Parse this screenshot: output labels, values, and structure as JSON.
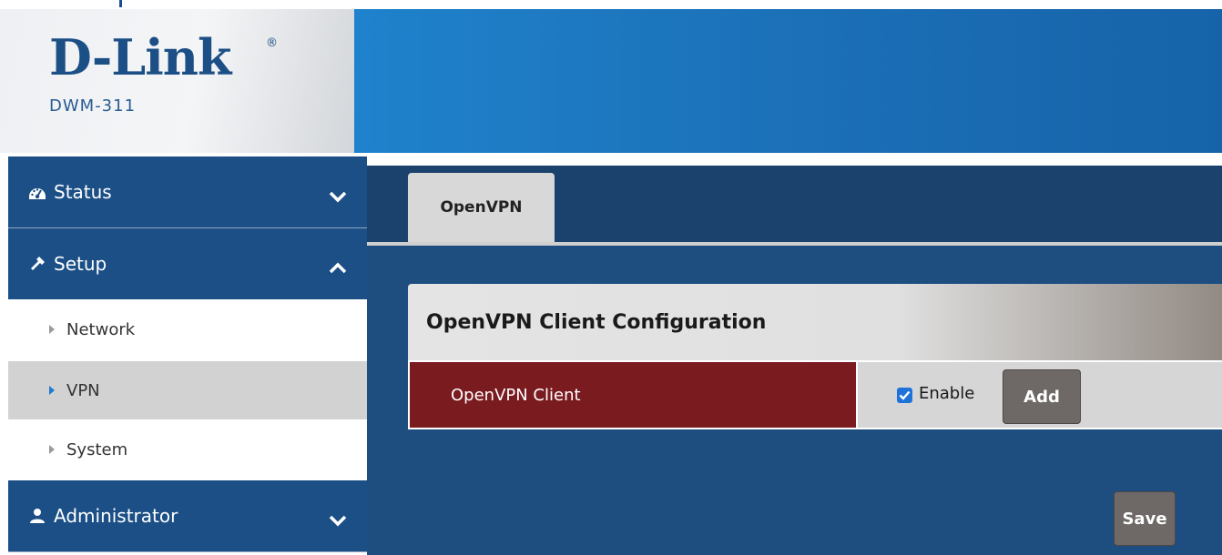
{
  "brand": {
    "logo_text": "D-Link",
    "registered_mark": "®",
    "model": "DWM-311"
  },
  "sidebar": {
    "sections": [
      {
        "label": "Status",
        "icon": "dashboard-icon",
        "state": "collapsed"
      },
      {
        "label": "Setup",
        "icon": "wrench-icon",
        "state": "expanded"
      },
      {
        "label": "Administrator",
        "icon": "user-icon",
        "state": "collapsed"
      }
    ],
    "setup_items": [
      {
        "label": "Network",
        "active": false
      },
      {
        "label": "VPN",
        "active": true
      },
      {
        "label": "System",
        "active": false
      }
    ]
  },
  "main": {
    "tabs": [
      {
        "label": "OpenVPN",
        "active": true
      }
    ],
    "panel_title": "OpenVPN Client Configuration",
    "row": {
      "label": "OpenVPN Client",
      "checkbox_label": "Enable",
      "checkbox_checked": true,
      "add_label": "Add"
    },
    "save_label": "Save"
  },
  "colors": {
    "brand_blue": "#1c4f86",
    "header_blue": "#1f82cc",
    "sidebar_head": "#1b4f86",
    "row_label_red": "#7a1b20",
    "button_gray": "#6e6866",
    "checkbox_blue": "#1f72d8"
  }
}
